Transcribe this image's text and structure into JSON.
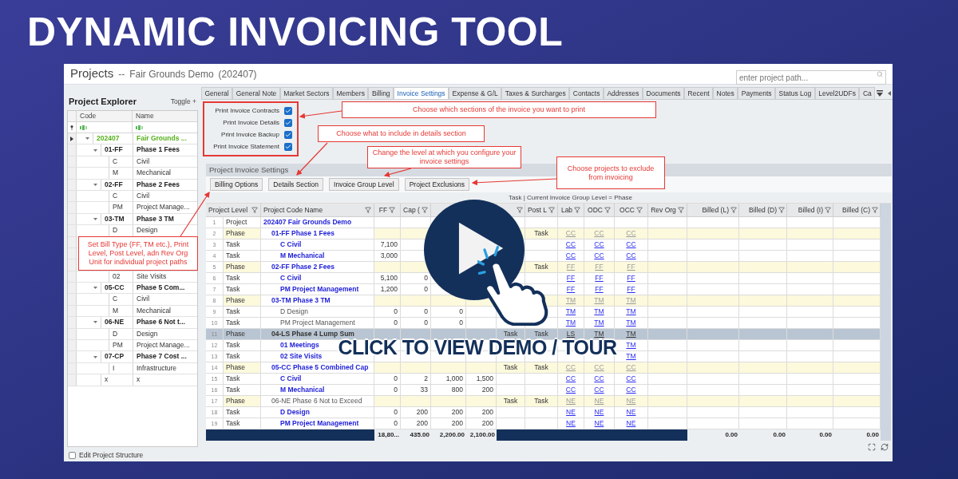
{
  "banner_title": "DYNAMIC INVOICING TOOL",
  "window": {
    "title": "Projects",
    "separator": "--",
    "project": "Fair Grounds Demo",
    "project_code": "(202407)",
    "search": {
      "placeholder": "enter project path..."
    }
  },
  "explorer": {
    "title": "Project Explorer",
    "toggle": "Toggle +",
    "columns": [
      "Code",
      "Name"
    ],
    "tree": [
      {
        "kind": "project",
        "code": "202407",
        "name": "Fair Grounds ...",
        "expanded": true,
        "selected": true,
        "children": [
          {
            "kind": "phase",
            "code": "01-FF",
            "name": "Phase 1 Fees",
            "expanded": true,
            "selected": false,
            "children": [
              {
                "kind": "task",
                "code": "C",
                "name": "Civil",
                "selected": false
              },
              {
                "kind": "task",
                "code": "M",
                "name": "Mechanical",
                "selected": false
              }
            ]
          },
          {
            "kind": "phase",
            "code": "02-FF",
            "name": "Phase 2 Fees",
            "expanded": true,
            "selected": false,
            "children": [
              {
                "kind": "task",
                "code": "C",
                "name": "Civil",
                "selected": false
              },
              {
                "kind": "task",
                "code": "PM",
                "name": "Project Manage...",
                "selected": false
              }
            ]
          },
          {
            "kind": "phase",
            "code": "03-TM",
            "name": "Phase 3 TM",
            "expanded": true,
            "selected": false,
            "children": [
              {
                "kind": "task",
                "code": "D",
                "name": "Design",
                "selected": false
              },
              {
                "kind": "covered",
                "selected": false
              }
            ]
          },
          {
            "kind": "covered",
            "selected": false,
            "children": [
              {
                "kind": "covered",
                "selected": false
              },
              {
                "kind": "task",
                "code": "02",
                "name": "Site Visits",
                "selected": false
              }
            ]
          },
          {
            "kind": "phase",
            "code": "05-CC",
            "name": "Phase 5 Com...",
            "expanded": true,
            "selected": false,
            "children": [
              {
                "kind": "task",
                "code": "C",
                "name": "Civil",
                "selected": false
              },
              {
                "kind": "task",
                "code": "M",
                "name": "Mechanical",
                "selected": false
              }
            ]
          },
          {
            "kind": "phase",
            "code": "06-NE",
            "name": "Phase 6 Not t...",
            "expanded": true,
            "selected": false,
            "children": [
              {
                "kind": "task",
                "code": "D",
                "name": "Design",
                "selected": false
              },
              {
                "kind": "task",
                "code": "PM",
                "name": "Project Manage...",
                "selected": false
              }
            ]
          },
          {
            "kind": "phase",
            "code": "07-CP",
            "name": "Phase 7 Cost ...",
            "expanded": true,
            "selected": false,
            "children": [
              {
                "kind": "task",
                "code": "I",
                "name": "Infrastructure",
                "selected": false
              }
            ]
          },
          {
            "kind": "task",
            "code": "x",
            "name": "x",
            "selected": false
          }
        ]
      }
    ],
    "edit_structure": {
      "label": "Edit Project Structure",
      "checked": false
    }
  },
  "tabs": [
    {
      "label": "General",
      "selected": false
    },
    {
      "label": "General Note",
      "selected": false
    },
    {
      "label": "Market Sectors",
      "selected": false
    },
    {
      "label": "Members",
      "selected": false
    },
    {
      "label": "Billing",
      "selected": false
    },
    {
      "label": "Invoice Settings",
      "selected": true
    },
    {
      "label": "Expense & G/L",
      "selected": false
    },
    {
      "label": "Taxes & Surcharges",
      "selected": false
    },
    {
      "label": "Contacts",
      "selected": false
    },
    {
      "label": "Addresses",
      "selected": false
    },
    {
      "label": "Documents",
      "selected": false
    },
    {
      "label": "Recent",
      "selected": false
    },
    {
      "label": "Notes",
      "selected": false
    },
    {
      "label": "Payments",
      "selected": false
    },
    {
      "label": "Status Log",
      "selected": false
    },
    {
      "label": "Level2UDFs",
      "selected": false
    },
    {
      "label": "Ca",
      "selected": false
    }
  ],
  "print_options": [
    {
      "label": "Print Invoice Contracts",
      "checked": true
    },
    {
      "label": "Print Invoice Details",
      "checked": true
    },
    {
      "label": "Print Invoice Backup",
      "checked": true
    },
    {
      "label": "Print Invoice Statement",
      "checked": true
    }
  ],
  "section": {
    "title": "Project Invoice Settings",
    "buttons": [
      "Billing Options",
      "Details Section",
      "Invoice Group Level",
      "Project Exclusions"
    ]
  },
  "grid": {
    "info": "Task | Current Invoice Group Level = Phase",
    "headers": {
      "level": "Project Level",
      "name": "Project Code Name",
      "ff": "FF",
      "cap": "Cap (",
      "post_l": "Post L",
      "lab": "Lab",
      "odc": "ODC",
      "occ": "OCC",
      "rev_org": "Rev Org",
      "billed_l": "Billed (L)",
      "billed_d": "Billed (D)",
      "billed_i": "Billed (I)",
      "billed_c": "Billed (C)"
    },
    "rows": [
      {
        "number": "1",
        "level": "Project",
        "kind": "project",
        "name": "202407 Fair Grounds Demo",
        "link": true,
        "selected": false
      },
      {
        "number": "2",
        "level": "Phase",
        "kind": "phase",
        "name": "01-FF Phase 1 Fees",
        "link": true,
        "selected": false,
        "cells": {
          "post_l": "Task",
          "lab": "CC",
          "odc": "CC",
          "occ": "CC"
        }
      },
      {
        "number": "3",
        "level": "Task",
        "kind": "task",
        "name": "C Civil",
        "link": true,
        "selected": false,
        "cells": {
          "ff": "7,100",
          "lab": "CC",
          "odc": "CC",
          "occ": "CC"
        }
      },
      {
        "number": "4",
        "level": "Task",
        "kind": "task",
        "name": "M Mechanical",
        "link": true,
        "selected": false,
        "cells": {
          "ff": "3,000",
          "lab": "CC",
          "odc": "CC",
          "occ": "CC"
        }
      },
      {
        "number": "5",
        "level": "Phase",
        "kind": "phase",
        "name": "02-FF Phase 2 Fees",
        "link": true,
        "selected": false,
        "cells": {
          "post_l": "Task",
          "lab": "FF",
          "odc": "FF",
          "occ": "FF"
        }
      },
      {
        "number": "6",
        "level": "Task",
        "kind": "task",
        "name": "C Civil",
        "link": true,
        "selected": false,
        "cells": {
          "ff": "5,100",
          "cap": "0",
          "lab": "FF",
          "odc": "FF",
          "occ": "FF"
        }
      },
      {
        "number": "7",
        "level": "Task",
        "kind": "task",
        "name": "PM Project Management",
        "link": true,
        "selected": false,
        "cells": {
          "ff": "1,200",
          "cap": "0",
          "lab": "FF",
          "odc": "FF",
          "occ": "FF"
        }
      },
      {
        "number": "8",
        "level": "Phase",
        "kind": "phase",
        "name": "03-TM Phase 3 TM",
        "link": true,
        "selected": false,
        "cells": {
          "lab": "TM",
          "odc": "TM",
          "occ": "TM"
        }
      },
      {
        "number": "9",
        "level": "Task",
        "kind": "task",
        "name": "D Design",
        "link": false,
        "selected": false,
        "cells": {
          "ff": "0",
          "cap": "0",
          "column_5": "0",
          "lab": "TM",
          "odc": "TM",
          "occ": "TM"
        }
      },
      {
        "number": "10",
        "level": "Task",
        "kind": "task",
        "name": "PM Project Management",
        "link": false,
        "selected": false,
        "cells": {
          "ff": "0",
          "cap": "0",
          "column_5": "0",
          "lab": "TM",
          "odc": "TM",
          "occ": "TM"
        }
      },
      {
        "number": "11",
        "level": "Phase",
        "kind": "phase",
        "name": "04-LS Phase 4 Lump Sum",
        "link": false,
        "selected": true,
        "cells": {
          "column_7": "Task",
          "post_l": "Task",
          "lab": "LS",
          "odc": "TM",
          "occ": "TM"
        }
      },
      {
        "number": "12",
        "level": "Task",
        "kind": "task",
        "name": "01 Meetings",
        "link": true,
        "selected": false,
        "cells": {
          "occ": "TM"
        }
      },
      {
        "number": "13",
        "level": "Task",
        "kind": "task",
        "name": "02 Site Visits",
        "link": true,
        "selected": false,
        "cells": {
          "occ": "TM"
        }
      },
      {
        "number": "14",
        "level": "Phase",
        "kind": "phase",
        "name": "05-CC Phase 5 Combined Cap",
        "link": true,
        "selected": false,
        "cells": {
          "column_7": "Task",
          "post_l": "Task",
          "lab": "CC",
          "odc": "CC",
          "occ": "CC"
        }
      },
      {
        "number": "15",
        "level": "Task",
        "kind": "task",
        "name": "C Civil",
        "link": true,
        "selected": false,
        "cells": {
          "ff": "0",
          "cap": "2",
          "column_5": "1,000",
          "column_6": "1,500",
          "lab": "CC",
          "odc": "CC",
          "occ": "CC"
        }
      },
      {
        "number": "16",
        "level": "Task",
        "kind": "task",
        "name": "M Mechanical",
        "link": true,
        "selected": false,
        "cells": {
          "ff": "0",
          "cap": "33",
          "column_5": "800",
          "column_6": "200",
          "lab": "CC",
          "odc": "CC",
          "occ": "CC"
        }
      },
      {
        "number": "17",
        "level": "Phase",
        "kind": "phase",
        "name": "06-NE Phase 6 Not to Exceed",
        "link": false,
        "selected": false,
        "cells": {
          "column_7": "Task",
          "post_l": "Task",
          "lab": "NE",
          "odc": "NE",
          "occ": "NE"
        }
      },
      {
        "number": "18",
        "level": "Task",
        "kind": "task",
        "name": "D Design",
        "link": true,
        "selected": false,
        "cells": {
          "ff": "0",
          "cap": "200",
          "column_5": "200",
          "column_6": "200",
          "lab": "NE",
          "odc": "NE",
          "occ": "NE"
        }
      },
      {
        "number": "19",
        "level": "Task",
        "kind": "task",
        "name": "PM Project Management",
        "link": true,
        "selected": false,
        "cells": {
          "ff": "0",
          "cap": "200",
          "column_5": "200",
          "column_6": "200",
          "lab": "NE",
          "odc": "NE",
          "occ": "NE"
        }
      }
    ],
    "totals": {
      "ff": "18,80...",
      "cap": "435.00",
      "column_5": "2,200.00",
      "column_6": "2,100.00",
      "billed_l": "0.00",
      "billed_d": "0.00",
      "billed_i": "0.00",
      "billed_c": "0.00"
    }
  },
  "callouts": [
    "Choose which sections of the invoice you want to print",
    "Choose what to include in details section",
    "Change the level at which you configure your invoice settings",
    "Choose projects to exclude from invoicing",
    "Set Bill Type (FF, TM etc.), Print Level, Post Level, adn Rev Org Unit for individual project paths"
  ],
  "cta": "CLICK TO VIEW DEMO / TOUR"
}
